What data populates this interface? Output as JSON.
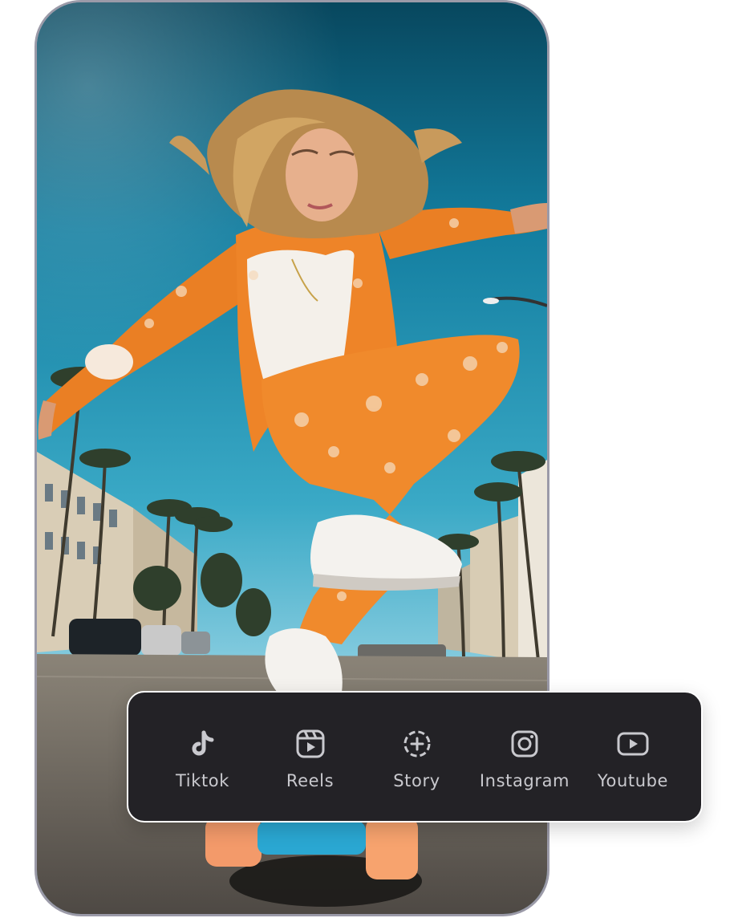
{
  "share_panel": {
    "items": [
      {
        "label": "Tiktok",
        "icon": "tiktok-icon"
      },
      {
        "label": "Reels",
        "icon": "reels-icon"
      },
      {
        "label": "Story",
        "icon": "story-add-icon"
      },
      {
        "label": "Instagram",
        "icon": "instagram-icon"
      },
      {
        "label": "Youtube",
        "icon": "youtube-icon"
      }
    ]
  },
  "colors": {
    "panel_bg": "#232226",
    "icon_color": "#c9c9ce",
    "frame_border": "#9b9aa8",
    "sky_top": "#0a4e66",
    "sky_bottom": "#8fd0e2",
    "outfit": "#f08a2c"
  }
}
